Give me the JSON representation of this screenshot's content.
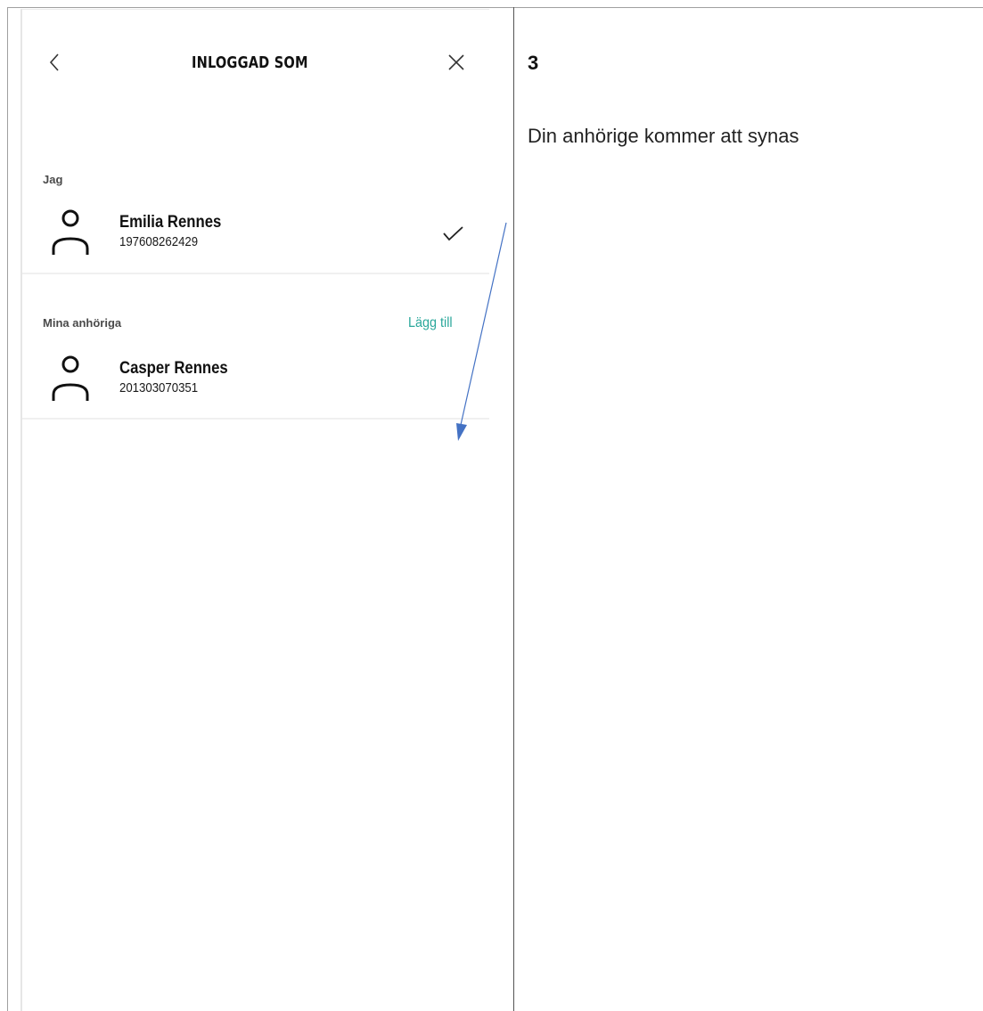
{
  "phone": {
    "header": {
      "back_icon": "chevron-left-icon",
      "title": "INLOGGAD SOM",
      "close_icon": "close-icon"
    },
    "self_section": {
      "label": "Jag",
      "person": {
        "icon": "person-icon",
        "name": "Emilia Rennes",
        "id": "197608262429",
        "selected": true,
        "selected_icon": "checkmark-icon"
      }
    },
    "relatives_section": {
      "label": "Mina anhöriga",
      "add_label": "Lägg till",
      "add_color": "#2aa79b",
      "people": [
        {
          "icon": "person-icon",
          "name": "Casper Rennes",
          "id": "201303070351"
        }
      ]
    }
  },
  "annotation": {
    "arrow_color": "#4472c4",
    "step_number": "3",
    "step_text": "Din anhörige kommer att synas"
  }
}
